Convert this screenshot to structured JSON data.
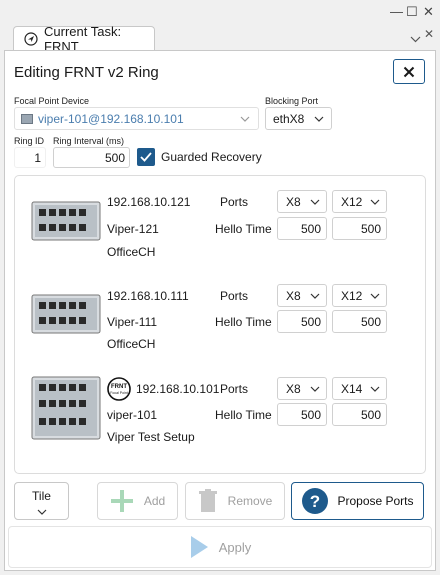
{
  "window": {
    "controls": [
      "—",
      "☐",
      "✕"
    ]
  },
  "tab": {
    "label": "Current Task: FRNT"
  },
  "panel": {
    "title": "Editing FRNT v2 Ring"
  },
  "focal_point": {
    "label": "Focal Point Device",
    "value": "viper-101@192.168.10.101"
  },
  "blocking_port": {
    "label": "Blocking Port",
    "value": "ethX8"
  },
  "ring_id": {
    "label": "Ring ID",
    "value": "1"
  },
  "ring_interval": {
    "label": "Ring Interval (ms)",
    "value": "500"
  },
  "guarded_recovery": {
    "label": "Guarded Recovery",
    "checked": true
  },
  "devices": [
    {
      "ip": "192.168.10.121",
      "name": "Viper-121",
      "location": "OfficeCH",
      "ports_label": "Ports",
      "port1": "X8",
      "port2": "X12",
      "hello_label": "Hello Time",
      "hello1": "500",
      "hello2": "500"
    },
    {
      "ip": "192.168.10.111",
      "name": "Viper-111",
      "location": "OfficeCH",
      "ports_label": "Ports",
      "port1": "X8",
      "port2": "X12",
      "hello_label": "Hello Time",
      "hello1": "500",
      "hello2": "500"
    },
    {
      "ip": "192.168.10.101",
      "name": "viper-101",
      "location": "Viper Test Setup",
      "ports_label": "Ports",
      "port1": "X8",
      "port2": "X14",
      "hello_label": "Hello Time",
      "hello1": "500",
      "hello2": "500",
      "badge": "FRNT Focal Point"
    }
  ],
  "toolbar": {
    "layout": "Tile",
    "add": "Add",
    "remove": "Remove",
    "propose": "Propose Ports",
    "apply": "Apply"
  }
}
